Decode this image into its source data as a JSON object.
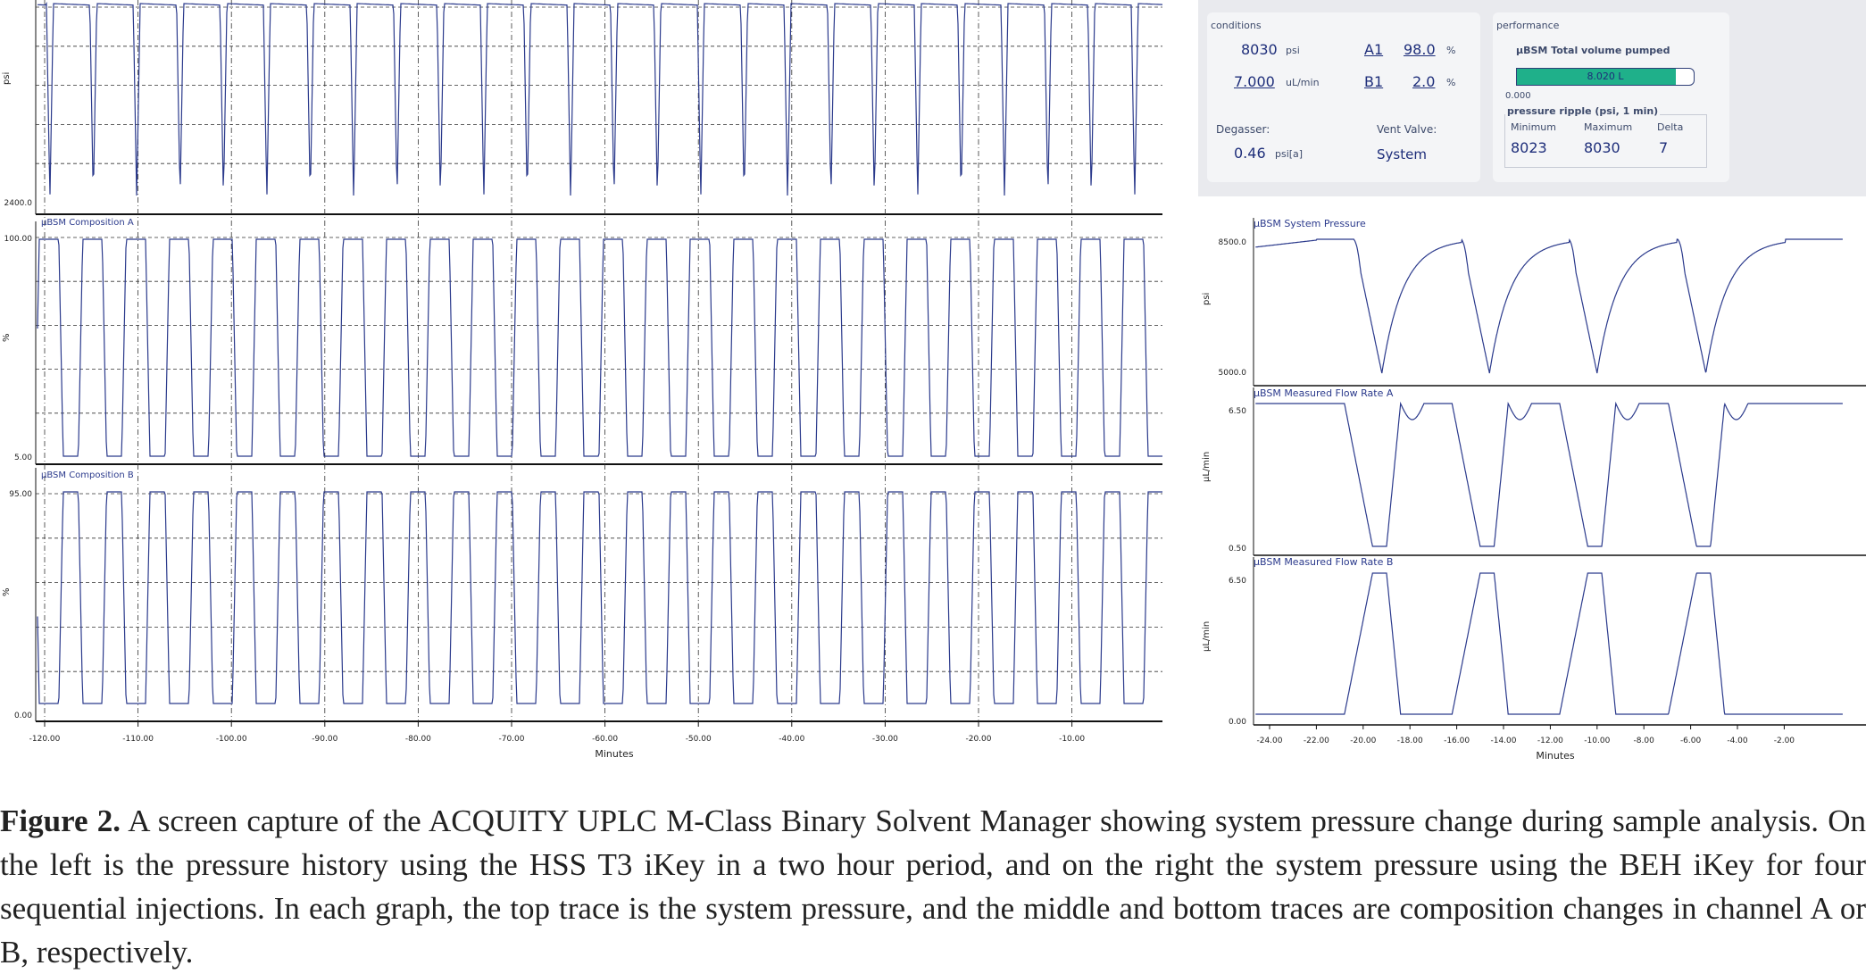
{
  "left": {
    "panels": [
      {
        "title": "",
        "y_top_label": "",
        "y_bottom_label": "2400.0",
        "y_axis_label": "psi"
      },
      {
        "title": "µBSM Composition A",
        "y_top_label": "100.00",
        "y_bottom_label": "5.00",
        "y_axis_label": "%"
      },
      {
        "title": "µBSM Composition B",
        "y_top_label": "95.00",
        "y_bottom_label": "0.00",
        "y_axis_label": "%"
      }
    ],
    "x_ticks": [
      "-120.00",
      "-110.00",
      "-100.00",
      "-90.00",
      "-80.00",
      "-70.00",
      "-60.00",
      "-50.00",
      "-40.00",
      "-30.00",
      "-20.00",
      "-10.00"
    ],
    "x_axis_label": "Minutes",
    "trace_color": "#2b3a8c"
  },
  "status": {
    "conditions_title": "conditions",
    "pressure_value": "8030",
    "pressure_unit": "psi",
    "flow_value": "7.000",
    "flow_unit": "uL/min",
    "solvent_a_name": "A1",
    "solvent_a_value": "98.0",
    "solvent_a_unit": "%",
    "solvent_b_name": "B1",
    "solvent_b_value": "2.0",
    "solvent_b_unit": "%",
    "degasser_label": "Degasser:",
    "degasser_value": "0.46",
    "degasser_unit": "psi[a]",
    "vent_label": "Vent Valve:",
    "vent_value": "System",
    "performance_title": "performance",
    "volume_label": "µBSM Total volume pumped",
    "volume_value": "8.020 L",
    "volume_scale_min": "0.000",
    "volume_fraction": 0.9,
    "ripple_title": "pressure ripple (psi, 1 min)",
    "ripple_min_label": "Minimum",
    "ripple_max_label": "Maximum",
    "ripple_delta_label": "Delta",
    "ripple_min": "8023",
    "ripple_max": "8030",
    "ripple_delta": "7",
    "fill_color": "#1fb08a"
  },
  "right": {
    "panels": [
      {
        "title": "µBSM System Pressure",
        "y_top_label": "8500.0",
        "y_bottom_label": "5000.0",
        "y_axis_label": "psi"
      },
      {
        "title": "µBSM Measured Flow Rate A",
        "y_top_label": "6.50",
        "y_bottom_label": "0.50",
        "y_axis_label": "µL/min"
      },
      {
        "title": "µBSM Measured Flow Rate B",
        "y_top_label": "6.50",
        "y_bottom_label": "0.00",
        "y_axis_label": "µL/min"
      }
    ],
    "x_ticks": [
      "-24.00",
      "-22.00",
      "-20.00",
      "-18.00",
      "-16.00",
      "-14.00",
      "-12.00",
      "-10.00",
      "-8.00",
      "-6.00",
      "-4.00",
      "-2.00"
    ],
    "x_axis_label": "Minutes"
  },
  "caption": {
    "bold": "Figure 2.",
    "text": " A screen capture of the ACQUITY UPLC M-Class Binary Solvent Manager showing system pressure change during sample analysis. On the left is the pressure history using the HSS T3 iKey in a two hour period, and on the right the system pressure using the BEH iKey for four sequential injections. In each graph, the top trace is the system pressure, and the middle and bottom traces are composition changes in channel A or B, respectively."
  }
}
